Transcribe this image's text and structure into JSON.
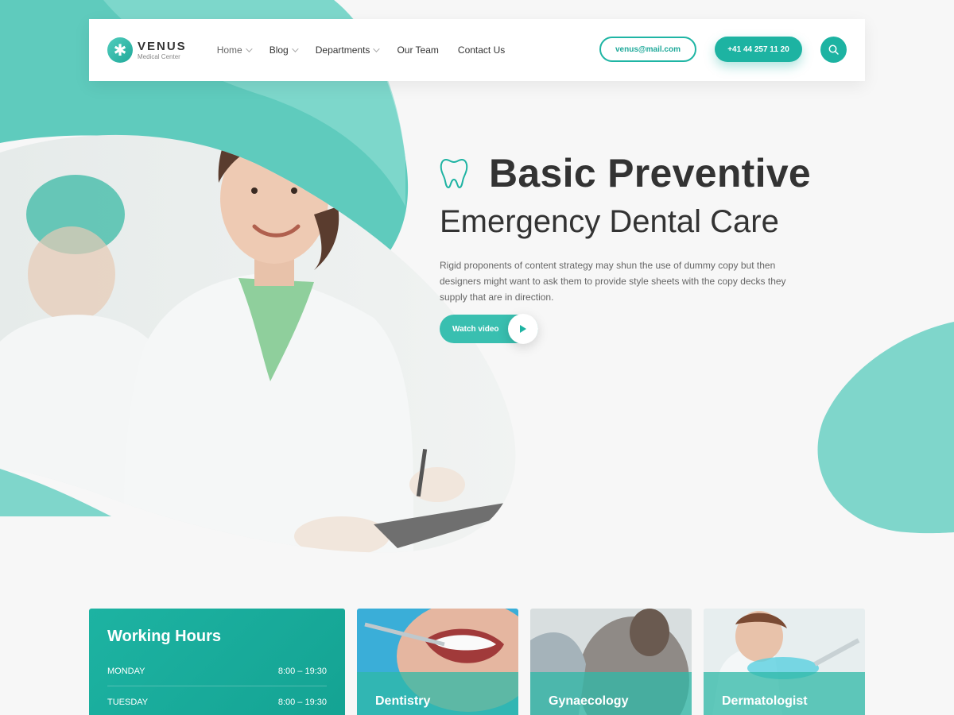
{
  "brand": {
    "name": "VENUS",
    "tagline": "Medical Center"
  },
  "nav": {
    "items": [
      {
        "label": "Home",
        "dropdown": true
      },
      {
        "label": "Blog",
        "dropdown": true
      },
      {
        "label": "Departments",
        "dropdown": true
      },
      {
        "label": "Our Team",
        "dropdown": false
      },
      {
        "label": "Contact Us",
        "dropdown": false
      }
    ]
  },
  "contact": {
    "email": "venus@mail.com",
    "phone": "+41 44 257 11 20"
  },
  "hero": {
    "title": "Basic Preventive",
    "subtitle": "Emergency Dental Care",
    "description": "Rigid proponents of content strategy may shun the use of dummy copy but then designers might want to ask them to provide style sheets with the copy decks they supply that are in direction.",
    "cta_label": "Watch video"
  },
  "hours": {
    "title": "Working Hours",
    "rows": [
      {
        "day": "MONDAY",
        "time": "8:00 – 19:30"
      },
      {
        "day": "TUESDAY",
        "time": "8:00 – 19:30"
      }
    ]
  },
  "departments": [
    {
      "label": "Dentistry"
    },
    {
      "label": "Gynaecology"
    },
    {
      "label": "Dermatologist"
    }
  ],
  "colors": {
    "accent": "#1db3a2",
    "accent_light": "#7fd6cb",
    "background": "#f7f7f7"
  }
}
